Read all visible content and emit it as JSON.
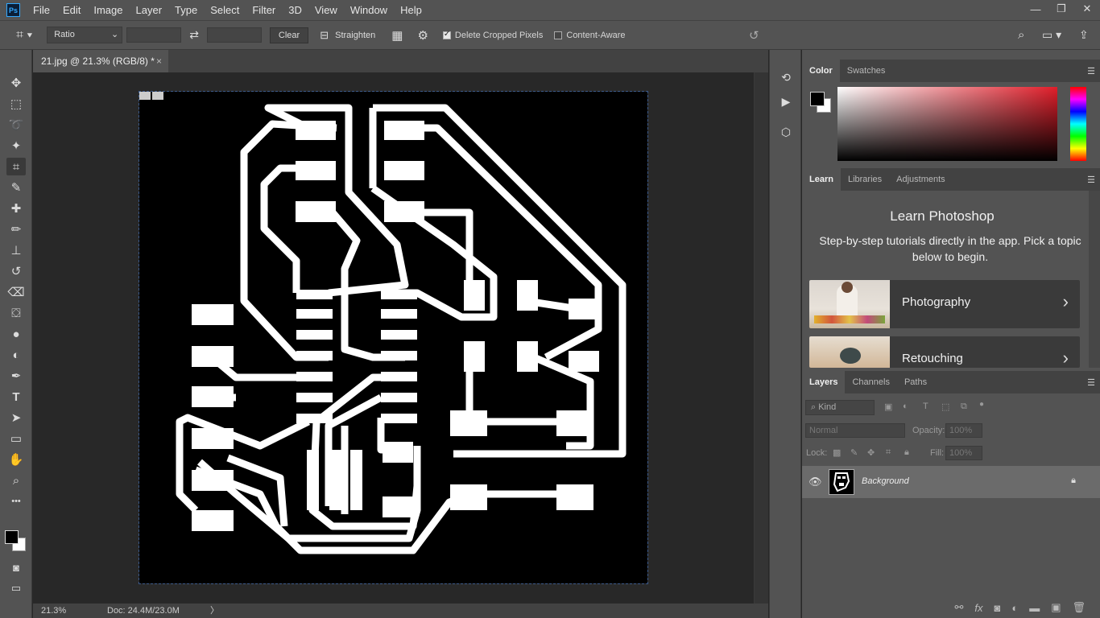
{
  "app": {
    "logo": "Ps",
    "menu": [
      "File",
      "Edit",
      "Image",
      "Layer",
      "Type",
      "Select",
      "Filter",
      "3D",
      "View",
      "Window",
      "Help"
    ],
    "window_controls": {
      "minimize": "—",
      "restore": "❐",
      "close": "✕"
    }
  },
  "options": {
    "ratio_label": "Ratio",
    "clear_label": "Clear",
    "straighten_label": "Straighten",
    "delete_cropped_label": "Delete Cropped Pixels",
    "delete_cropped_checked": true,
    "content_aware_label": "Content-Aware",
    "content_aware_checked": false
  },
  "document": {
    "tab_title": "21.jpg @ 21.3% (RGB/8) *",
    "zoom": "21.3%",
    "doc_info": "Doc: 24.4M/23.0M",
    "status_arrow": "〉"
  },
  "color_panel": {
    "tabs": [
      "Color",
      "Swatches"
    ],
    "foreground": "#000000",
    "background": "#ffffff"
  },
  "learn_panel": {
    "tabs": [
      "Learn",
      "Libraries",
      "Adjustments"
    ],
    "title": "Learn Photoshop",
    "description": "Step-by-step tutorials directly in the app. Pick a topic below to begin.",
    "cards": [
      "Photography",
      "Retouching"
    ]
  },
  "layers_panel": {
    "tabs": [
      "Layers",
      "Channels",
      "Paths"
    ],
    "kind_label": "Kind",
    "blend_mode": "Normal",
    "opacity_label": "Opacity:",
    "opacity_value": "100%",
    "lock_label": "Lock:",
    "fill_label": "Fill:",
    "fill_value": "100%",
    "layer_name": "Background"
  },
  "icons": {
    "move": "✥",
    "marquee": "⬚",
    "lasso": "➰",
    "wand": "✦",
    "crop": "⌗",
    "eyedropper": "✎",
    "heal": "✚",
    "brush": "✏",
    "stamp": "⊥",
    "history": "↺",
    "eraser": "⌫",
    "bucket": "⛋",
    "blur": "●",
    "dodge": "◐",
    "pen": "✒",
    "type": "T",
    "path-select": "➤",
    "shape": "▭",
    "hand": "✋",
    "zoom": "⌕",
    "more": "•••"
  }
}
